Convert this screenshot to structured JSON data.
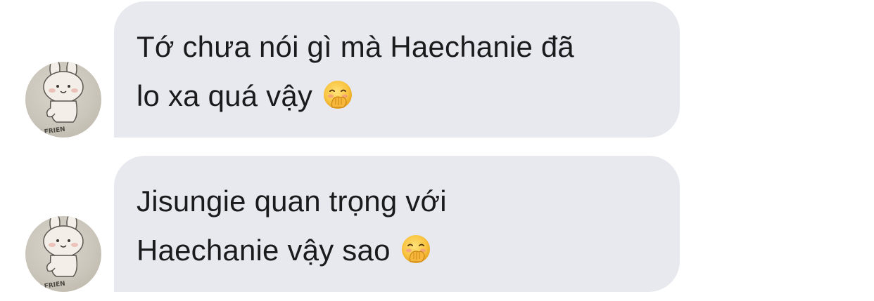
{
  "messages": [
    {
      "lines": [
        "Tớ chưa nói gì mà Haechanie đã",
        "lo xa quá vậy"
      ],
      "emoji": "hand-over-mouth-emoji"
    },
    {
      "lines": [
        "Jisungie quan trọng với",
        "Haechanie vậy sao"
      ],
      "emoji": "hand-over-mouth-emoji"
    }
  ],
  "colors": {
    "bubble": "#e8e9ee",
    "text": "#1b1b1d",
    "background": "#ffffff"
  }
}
